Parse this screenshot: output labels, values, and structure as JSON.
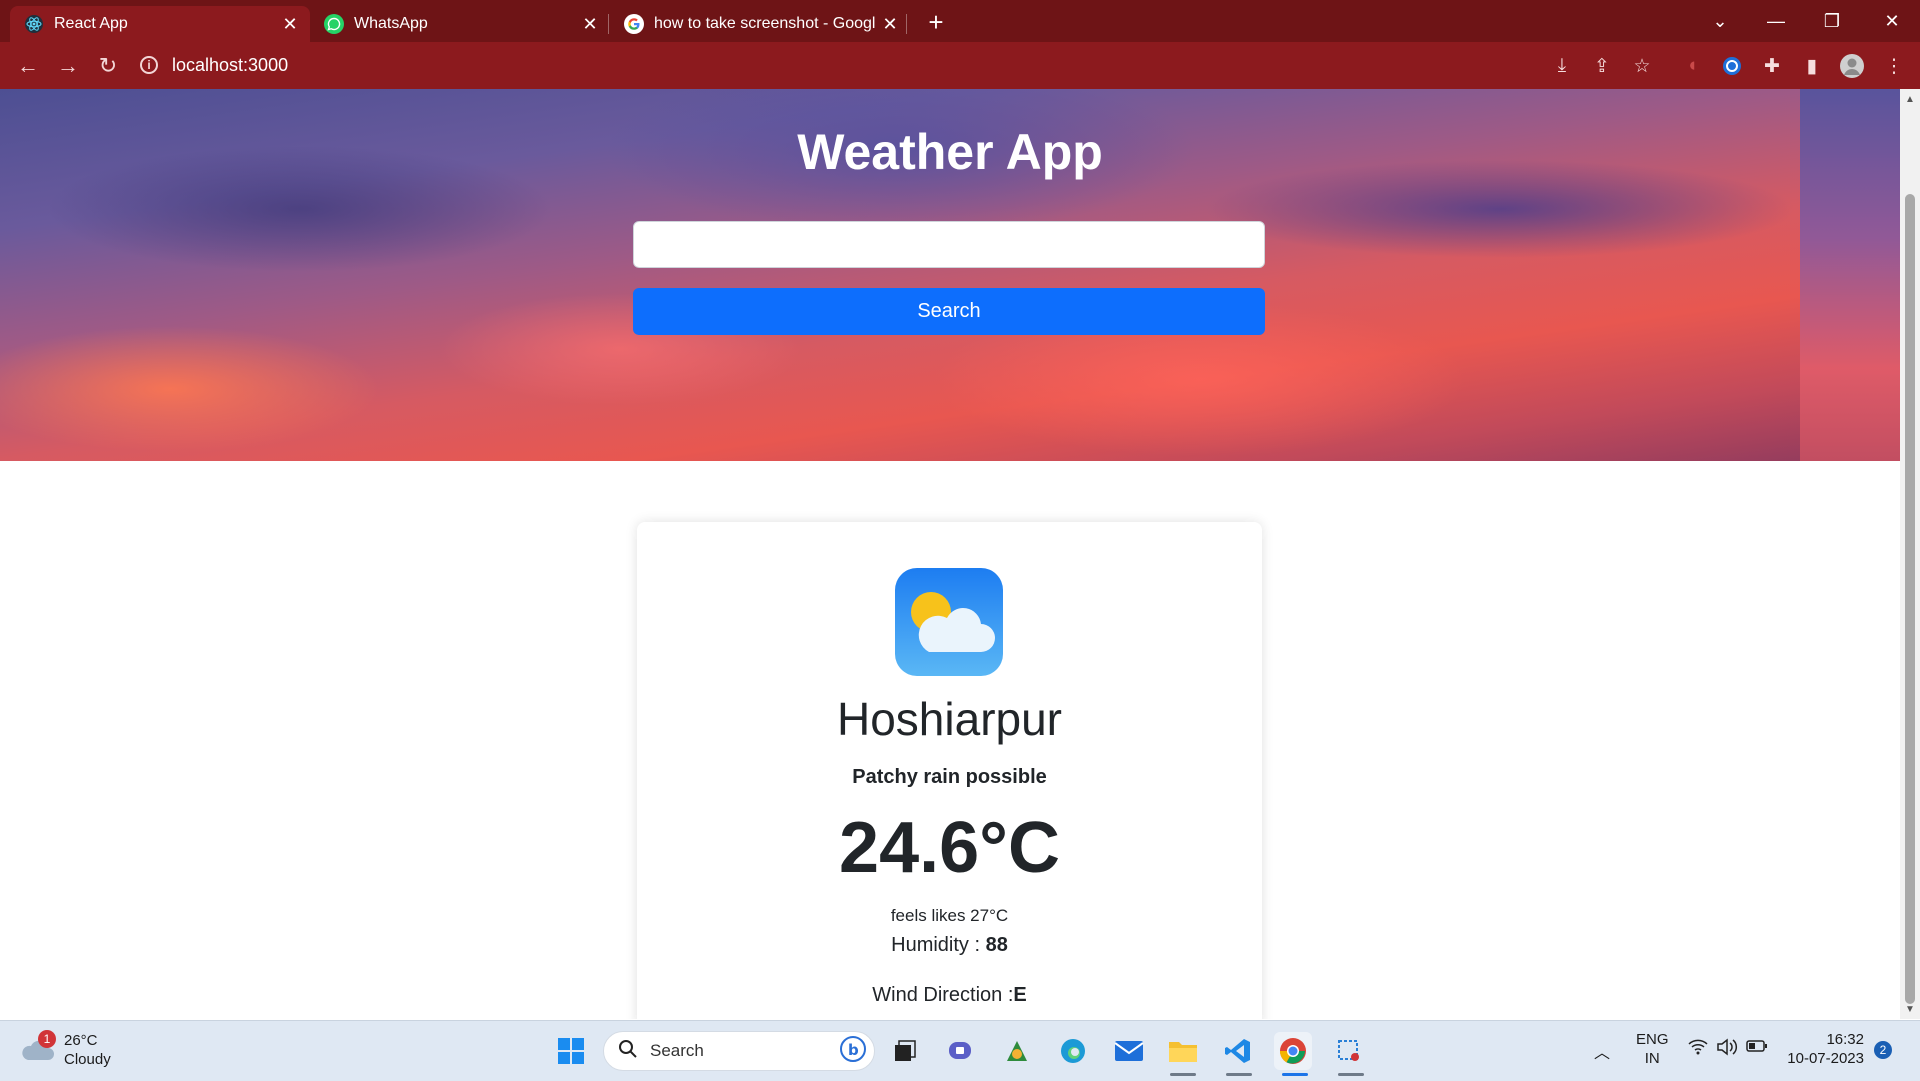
{
  "browser": {
    "tabs": [
      {
        "label": "React App",
        "icon": "react-icon",
        "active": true
      },
      {
        "label": "WhatsApp",
        "icon": "whatsapp-icon",
        "active": false
      },
      {
        "label": "how to take screenshot - Google",
        "icon": "google-icon",
        "active": false
      }
    ],
    "new_tab": "+",
    "url": "localhost:3000",
    "colors": {
      "tabstrip": "#6e1416",
      "toolbar": "#8c1a1e"
    }
  },
  "page": {
    "title": "Weather App",
    "search": {
      "value": "",
      "placeholder": ""
    },
    "search_button": "Search",
    "colors": {
      "button": "#0d6efd"
    }
  },
  "weather": {
    "icon": "partly-cloudy-icon",
    "city": "Hoshiarpur",
    "condition": "Patchy rain possible",
    "temperature": "24.6°C",
    "feels_like": "feels likes 27°C",
    "humidity_label": "Humidity : ",
    "humidity_value": "88",
    "wind_label": "Wind Direction :",
    "wind_value": "E"
  },
  "taskbar": {
    "weather_temp": "26°C",
    "weather_desc": "Cloudy",
    "weather_badge": "1",
    "search_label": "Search",
    "lang_top": "ENG",
    "lang_bottom": "IN",
    "time": "16:32",
    "date": "10-07-2023",
    "notification_count": "2"
  }
}
